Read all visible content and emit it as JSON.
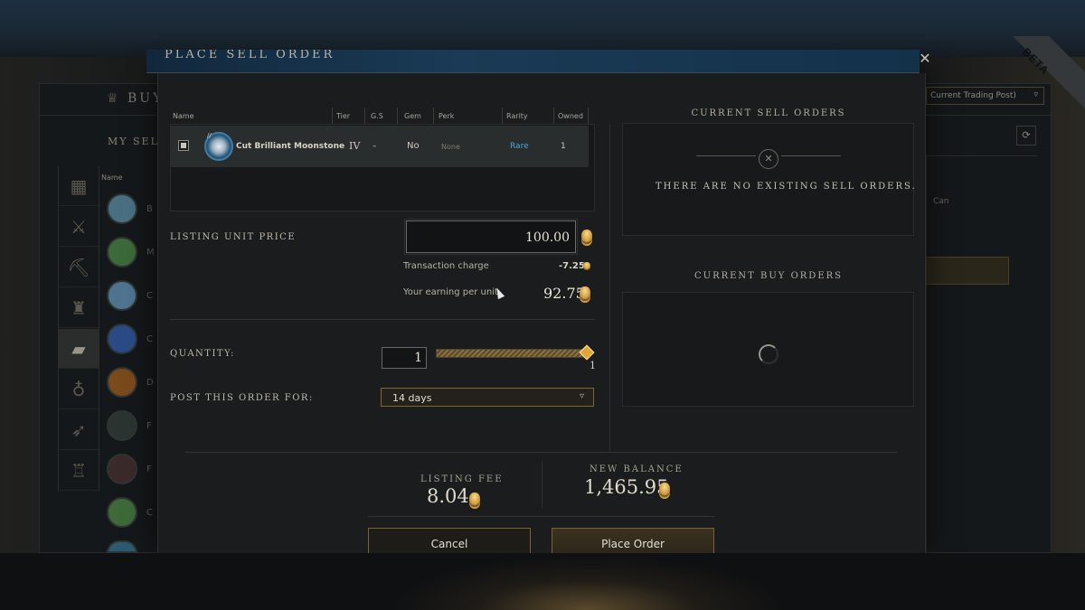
{
  "modal": {
    "title": "PLACE SELL ORDER",
    "close_glyph": "✕"
  },
  "background": {
    "buy_tab": "BUY",
    "my_sell_label": "MY SEL",
    "name_col": "Name",
    "trading_post_select": "Current Trading Post)",
    "can_text": "Can",
    "item_letters": [
      "B",
      "M",
      "C",
      "C",
      "D",
      "F",
      "F",
      "C"
    ],
    "category_icons": [
      "grid-icon",
      "swords-icon",
      "pickaxe-icon",
      "armor-icon",
      "resources-icon",
      "bag-icon",
      "arrow-icon",
      "chair-icon"
    ],
    "refresh_glyph": "⟳",
    "beta_badge": "BETA"
  },
  "table": {
    "headers": {
      "name": "Name",
      "tier": "Tier",
      "gs": "G.S",
      "gem": "Gem",
      "perk": "Perk",
      "rarity": "Rarity",
      "owned": "Owned"
    },
    "row": {
      "name": "Cut Brilliant Moonstone",
      "tier": "IV",
      "gs": "–",
      "gem": "No",
      "perk": "None",
      "rarity": "Rare",
      "owned": "1",
      "rarity_color": "#4aa6e0"
    }
  },
  "pricing": {
    "listing_label": "LISTING UNIT PRICE",
    "unit_price": "100.00",
    "transaction_label": "Transaction charge",
    "transaction_value": "-7.25",
    "earning_label": "Your earning per unit",
    "earning_value": "92.75"
  },
  "quantity": {
    "label": "QUANTITY:",
    "value": "1",
    "slider_max": "1",
    "slider_fraction": 1.0
  },
  "duration": {
    "label": "POST THIS ORDER FOR:",
    "value": "14 days"
  },
  "sell_orders": {
    "title": "CURRENT SELL ORDERS",
    "empty": "THERE ARE NO EXISTING SELL ORDERS."
  },
  "buy_orders": {
    "title": "CURRENT BUY ORDERS"
  },
  "footer": {
    "fee_label": "LISTING FEE",
    "fee_value": "8.04",
    "balance_label": "NEW BALANCE",
    "balance_value": "1,465.95",
    "cancel": "Cancel",
    "place": "Place Order"
  },
  "colors": {
    "accent_gold": "#e0a538",
    "rarity_rare": "#4aa6e0"
  }
}
